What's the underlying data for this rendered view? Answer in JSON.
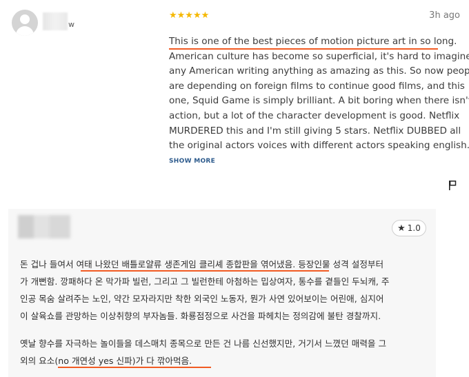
{
  "review1": {
    "stars": "★★★★★",
    "time": "3h ago",
    "name_suffix": "w",
    "lines": [
      "This is one of the best pieces of motion picture art in so long.",
      "American culture has become so superficial, it's hard to imagine",
      "any American writing anything as amazing as this. So now people",
      "are depending on foreign films to continue good films, and this",
      "one, Squid Game is simply brilliant. A bit boring when there isn't",
      "action, but a lot of the character development is good. Netflix",
      "MURDERED this and I'm still giving 5 stars. Netflix DUBBED all",
      "the original actors voices with different actors speaking english...."
    ],
    "show_more": "SHOW MORE",
    "flag_icon": "flag-icon"
  },
  "review2": {
    "rating": "1.0",
    "star_icon": "star-icon",
    "lines": [
      "돈 겁나 들여서 여태 나왔던 배틀로얄류 생존게임 클리셰 종합판을 엮어냈음. 등장인물 성격 설정부터",
      "가 개뻔함. 깡패하다 온 막가파 빌런, 그리고 그 빌런한테 아첨하는 밉상여자, 통수를 곁들인 두뇌캐, 주",
      "인공 목숨 살려주는 노인, 약간 모자라지만 착한 외국인 노동자, 뭔가 사연 있어보이는 어린애, 심지어",
      "이 살육쇼를 관망하는 이상취향의 부자놈들. 화룡점정으로 사건을 파헤치는 정의감에 불탄 경찰까지.",
      "옛날 향수를 자극하는 놀이들을 데스매치 종목으로 만든 건 나름 신선했지만, 거기서 느꼈던 매력을 그",
      "외의 요소(no 개연성 yes 신파)가 다 깎아먹음."
    ]
  },
  "colors": {
    "underline": "#f15a22",
    "star": "#f5b800",
    "link": "#2c5a8c"
  }
}
